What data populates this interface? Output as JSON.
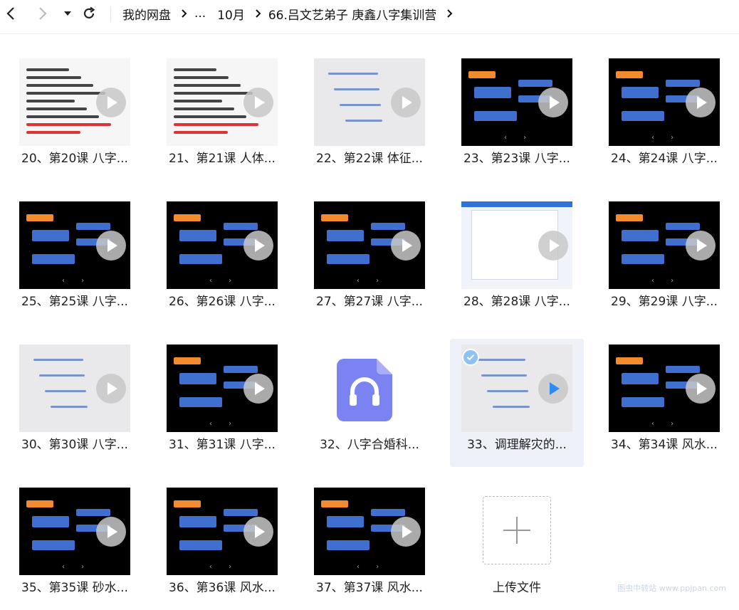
{
  "breadcrumb": {
    "items": [
      "我的网盘",
      "...",
      "10月",
      "66.吕文艺弟子 庚鑫八字集训营"
    ]
  },
  "files": [
    {
      "label": "20、第20课 八字...",
      "kind": "video",
      "theme": "doc"
    },
    {
      "label": "21、第21课 人体...",
      "kind": "video",
      "theme": "doc"
    },
    {
      "label": "22、第22课 体征...",
      "kind": "video",
      "theme": "white"
    },
    {
      "label": "23、第23课 八字...",
      "kind": "video",
      "theme": "dark"
    },
    {
      "label": "24、第24课 八字...",
      "kind": "video",
      "theme": "dark"
    },
    {
      "label": "25、第25课 八字...",
      "kind": "video",
      "theme": "dark"
    },
    {
      "label": "26、第26课 八字...",
      "kind": "video",
      "theme": "dark"
    },
    {
      "label": "27、第27课 八字...",
      "kind": "video",
      "theme": "dark"
    },
    {
      "label": "28、第28课 八字...",
      "kind": "video",
      "theme": "desktop"
    },
    {
      "label": "29、第29课 八字...",
      "kind": "video",
      "theme": "dark"
    },
    {
      "label": "30、第30课 八字...",
      "kind": "video",
      "theme": "white"
    },
    {
      "label": "31、第31课 八字...",
      "kind": "video",
      "theme": "dark"
    },
    {
      "label": "32、八字合婚科...",
      "kind": "audio",
      "theme": "none"
    },
    {
      "label": "33、调理解灾的...",
      "kind": "video",
      "theme": "white",
      "selected": true
    },
    {
      "label": "34、第34课 风水...",
      "kind": "video",
      "theme": "dark"
    },
    {
      "label": "35、第35课 砂水...",
      "kind": "video",
      "theme": "dark"
    },
    {
      "label": "36、第36课 风水...",
      "kind": "video",
      "theme": "dark"
    },
    {
      "label": "37、第37课 风水...",
      "kind": "video",
      "theme": "dark"
    },
    {
      "label": "上传文件",
      "kind": "upload",
      "theme": "none"
    }
  ],
  "colors": {
    "accent": "#2f8af5",
    "selected_bg": "#eef1f8",
    "audio_icon": "#7b83f2"
  },
  "watermark": "图虫中转站 www.ppjpan.com"
}
